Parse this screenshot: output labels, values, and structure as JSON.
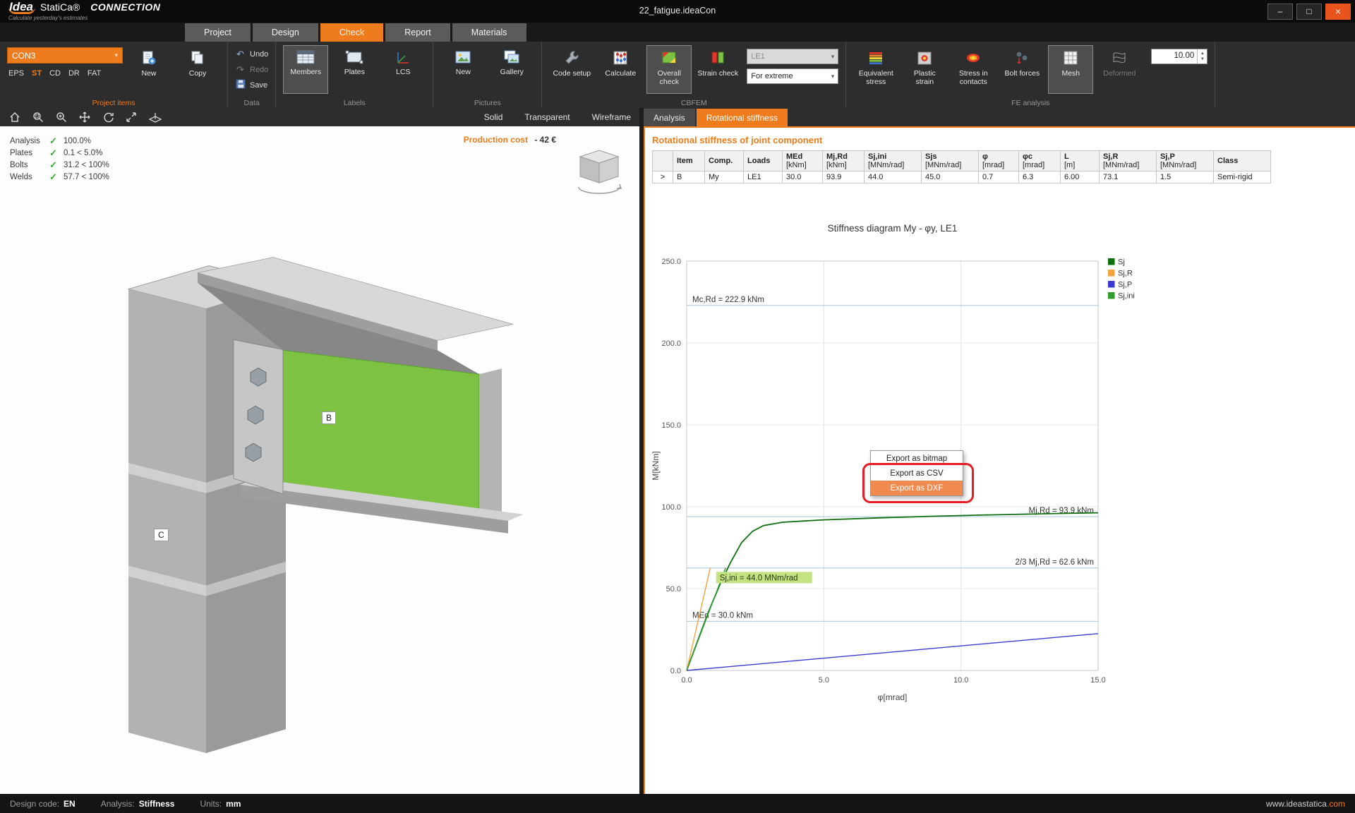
{
  "window": {
    "logo_idea": "Idea",
    "logo_statica": "StatiCa®",
    "app_name": "CONNECTION",
    "tagline": "Calculate yesterday's estimates",
    "document_title": "22_fatigue.ideaCon",
    "minimize_glyph": "–",
    "maximize_glyph": "□",
    "close_glyph": "×"
  },
  "ribbon": {
    "tabs": [
      "Project",
      "Design",
      "Check",
      "Report",
      "Materials"
    ],
    "active_tab": "Check",
    "project_items": {
      "group_label": "Project items",
      "connection": "CON3",
      "modes": [
        "EPS",
        "ST",
        "CD",
        "DR",
        "FAT"
      ],
      "active_mode": "ST",
      "new_label": "New",
      "copy_label": "Copy"
    },
    "data": {
      "group_label": "Data",
      "undo": "Undo",
      "redo": "Redo",
      "save": "Save"
    },
    "labels": {
      "group_label": "Labels",
      "members": "Members",
      "plates": "Plates",
      "lcs": "LCS"
    },
    "pictures": {
      "group_label": "Pictures",
      "new": "New",
      "gallery": "Gallery"
    },
    "cbfem": {
      "group_label": "CBFEM",
      "code_setup": "Code setup",
      "calculate": "Calculate",
      "overall_check": "Overall check",
      "strain_check": "Strain check",
      "load_case": "LE1",
      "extreme": "For extreme"
    },
    "fe_analysis": {
      "group_label": "FE analysis",
      "equivalent_stress": "Equivalent stress",
      "plastic_strain": "Plastic strain",
      "stress_contacts": "Stress in contacts",
      "bolt_forces": "Bolt forces",
      "mesh": "Mesh",
      "deformed": "Deformed",
      "scale": "10.00"
    }
  },
  "viewport": {
    "toolbar_icons": [
      "home",
      "zoom-window",
      "zoom",
      "pan",
      "rotate-view",
      "zoom-extents",
      "clipping"
    ],
    "view_modes": [
      "Solid",
      "Transparent",
      "Wireframe"
    ],
    "check_glyph": "✓",
    "checks": [
      {
        "label": "Analysis",
        "value": "100.0%"
      },
      {
        "label": "Plates",
        "value": "0.1 < 5.0%"
      },
      {
        "label": "Bolts",
        "value": "31.2 < 100%"
      },
      {
        "label": "Welds",
        "value": "57.7 < 100%"
      }
    ],
    "production_cost_label": "Production cost",
    "production_cost_value": "-  42 €",
    "member_b": "B",
    "member_c": "C"
  },
  "results_panel": {
    "tabs": [
      "Analysis",
      "Rotational stiffness"
    ],
    "active_tab": "Rotational stiffness",
    "section_title": "Rotational stiffness of joint component",
    "table": {
      "columns": [
        {
          "name": "",
          "unit": ""
        },
        {
          "name": "Item",
          "unit": ""
        },
        {
          "name": "Comp.",
          "unit": ""
        },
        {
          "name": "Loads",
          "unit": ""
        },
        {
          "name": "MEd",
          "unit": "[kNm]"
        },
        {
          "name": "Mj,Rd",
          "unit": "[kNm]"
        },
        {
          "name": "Sj,ini",
          "unit": "[MNm/rad]"
        },
        {
          "name": "Sjs",
          "unit": "[MNm/rad]"
        },
        {
          "name": "φ",
          "unit": "[mrad]"
        },
        {
          "name": "φc",
          "unit": "[mrad]"
        },
        {
          "name": "L",
          "unit": "[m]"
        },
        {
          "name": "Sj,R",
          "unit": "[MNm/rad]"
        },
        {
          "name": "Sj,P",
          "unit": "[MNm/rad]"
        },
        {
          "name": "Class",
          "unit": ""
        }
      ],
      "rows": [
        {
          "expander": ">",
          "cells": [
            "B",
            "My",
            "LE1",
            "30.0",
            "93.9",
            "44.0",
            "45.0",
            "0.7",
            "6.3",
            "6.00",
            "73.1",
            "1.5",
            "Semi-rigid"
          ]
        }
      ]
    }
  },
  "context_menu": {
    "items": [
      {
        "label": "Export as bitmap",
        "highlighted": false
      },
      {
        "label": "Export as CSV",
        "highlighted": false
      },
      {
        "label": "Export as DXF",
        "highlighted": true
      }
    ]
  },
  "chart_data": {
    "type": "line",
    "title": "Stiffness diagram My - φy, LE1",
    "xlabel": "φ[mrad]",
    "ylabel": "M[kNm]",
    "xlim": [
      0,
      15
    ],
    "ylim": [
      0,
      250
    ],
    "xticks": [
      0,
      5,
      10,
      15
    ],
    "yticks": [
      0,
      50,
      100,
      150,
      200,
      250
    ],
    "grid": true,
    "legend_position": "top-right-outside",
    "series": [
      {
        "name": "Sj",
        "color": "#0e6f0e",
        "points": [
          [
            0,
            0
          ],
          [
            0.4,
            18
          ],
          [
            0.8,
            36
          ],
          [
            1.2,
            52
          ],
          [
            1.6,
            66
          ],
          [
            2.0,
            78
          ],
          [
            2.4,
            85
          ],
          [
            2.8,
            88.5
          ],
          [
            3.5,
            90.5
          ],
          [
            5,
            92
          ],
          [
            7,
            93.2
          ],
          [
            9,
            94.2
          ],
          [
            11,
            95
          ],
          [
            13,
            95.7
          ],
          [
            15,
            96.3
          ]
        ]
      },
      {
        "name": "Sj,R",
        "color": "#f2a33c",
        "points": [
          [
            0,
            0
          ],
          [
            0.86,
            62.6
          ]
        ]
      },
      {
        "name": "Sj,P",
        "color": "#3a3ad0",
        "points": [
          [
            0,
            0
          ],
          [
            15,
            22.5
          ]
        ]
      },
      {
        "name": "Sj,ini",
        "color": "#2f9e2f",
        "points": [
          [
            0,
            0
          ],
          [
            1.42,
            62.6
          ]
        ]
      }
    ],
    "reference_lines": [
      {
        "value": 222.9,
        "label": "Mc,Rd = 222.9 kNm",
        "label_side": "left"
      },
      {
        "value": 93.9,
        "label": "Mj,Rd = 93.9 kNm",
        "label_side": "right"
      },
      {
        "value": 62.6,
        "label": "2/3 Mj,Rd = 62.6 kNm",
        "label_side": "right"
      },
      {
        "value": 30.0,
        "label": "MEd = 30.0 kNm",
        "label_side": "left"
      }
    ],
    "annotation": {
      "text": "Sj,ini = 44.0 MNm/rad",
      "x": 1.15,
      "y": 55,
      "highlight": "#c3e383"
    }
  },
  "status_bar": {
    "items": [
      {
        "label": "Design code:",
        "value": "EN"
      },
      {
        "label": "Analysis:",
        "value": "Stiffness"
      },
      {
        "label": "Units:",
        "value": "mm"
      }
    ],
    "website": "www.ideastatica",
    "website_suffix": ".com"
  },
  "colors": {
    "accent": "#ee7b1c",
    "check_green": "#3baa35",
    "member_green": "#7dc242",
    "ref_line": "#a9c5d8",
    "menu_ring": "#e51c23"
  }
}
